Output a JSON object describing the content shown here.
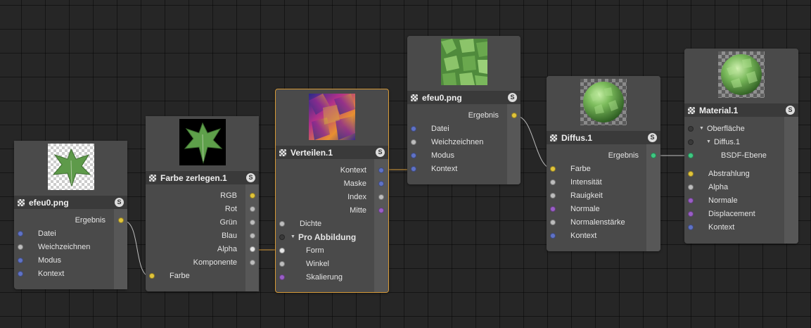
{
  "colors": {
    "blue": "#5f72c6",
    "grey": "#bdbdbd",
    "yellow": "#e1c43a",
    "purple": "#9a5ec6",
    "green": "#3fc882",
    "dark": "#393939",
    "selected_border": "#d79a38"
  },
  "nodes": {
    "efeu_left": {
      "title": "efeu0.png",
      "s_label": "S",
      "output": "Ergebnis",
      "inputs": [
        "Datei",
        "Weichzeichnen",
        "Modus",
        "Kontext"
      ]
    },
    "farbe": {
      "title": "Farbe zerlegen.1",
      "s_label": "S",
      "outputs": [
        "RGB",
        "Rot",
        "Grün",
        "Blau",
        "Alpha",
        "Komponente"
      ],
      "input": "Farbe"
    },
    "verteilen": {
      "title": "Verteilen.1",
      "s_label": "S",
      "outputs": [
        "Kontext",
        "Maske",
        "Index",
        "Mitte"
      ],
      "inputs": [
        "Dichte",
        "Pro Abbildung",
        "Form",
        "Winkel",
        "Skalierung"
      ]
    },
    "efeu_mid": {
      "title": "efeu0.png",
      "s_label": "S",
      "output": "Ergebnis",
      "inputs": [
        "Datei",
        "Weichzeichnen",
        "Modus",
        "Kontext"
      ]
    },
    "diffus": {
      "title": "Diffus.1",
      "s_label": "S",
      "output": "Ergebnis",
      "inputs": [
        "Farbe",
        "Intensität",
        "Rauigkeit",
        "Normale",
        "Normalenstärke",
        "Kontext"
      ]
    },
    "material": {
      "title": "Material.1",
      "s_label": "S",
      "tree": [
        "Oberfläche",
        "Diffus.1",
        "BSDF-Ebene"
      ],
      "inputs": [
        "Abstrahlung",
        "Alpha",
        "Normale",
        "Displacement",
        "Kontext"
      ]
    }
  },
  "icons": {
    "title_icon": "checker-node-icon",
    "expand": "triangle-down-icon"
  }
}
